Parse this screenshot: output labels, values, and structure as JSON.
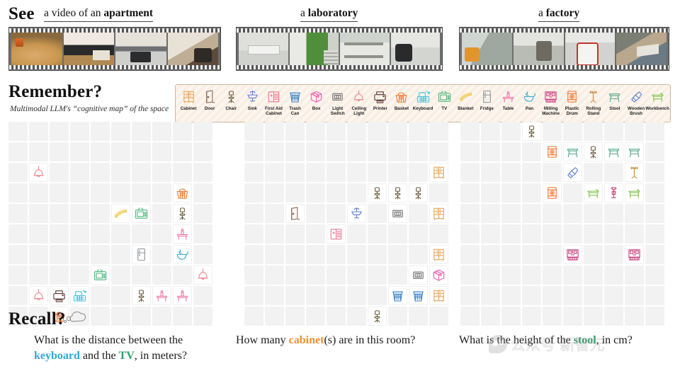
{
  "sections": {
    "see": "See",
    "remember": "Remember?",
    "recall": "Recall?",
    "remember_subtitle": "Multimodal LLM's “cognitive map” of the space"
  },
  "columns": [
    {
      "id": "apartment",
      "heading_prefix": "a video of an ",
      "heading_key": "apartment"
    },
    {
      "id": "laboratory",
      "heading_prefix": "a ",
      "heading_key": "laboratory"
    },
    {
      "id": "factory",
      "heading_prefix": "a ",
      "heading_key": "factory"
    }
  ],
  "legend": {
    "items": [
      {
        "name": "Cabinet",
        "icon": "cabinet",
        "color": "#E8A35C"
      },
      {
        "name": "Door",
        "icon": "door",
        "color": "#8A6B52"
      },
      {
        "name": "Chair",
        "icon": "chair",
        "color": "#6B5B3E"
      },
      {
        "name": "Sink",
        "icon": "sink",
        "color": "#5B7FC7"
      },
      {
        "name": "First Aid\nCabinet",
        "icon": "first-aid-cabinet",
        "color": "#F2728E"
      },
      {
        "name": "Trash\nCan",
        "icon": "trash-can",
        "color": "#3E86C9"
      },
      {
        "name": "Box",
        "icon": "box",
        "color": "#F25BB0"
      },
      {
        "name": "Light\nSwitch",
        "icon": "light-switch",
        "color": "#6E6E6E"
      },
      {
        "name": "Ceiling\nLight",
        "icon": "ceiling-light",
        "color": "#F2868E"
      },
      {
        "name": "Printer",
        "icon": "printer",
        "color": "#5C3A33"
      },
      {
        "name": "Basket",
        "icon": "basket",
        "color": "#F2742C"
      },
      {
        "name": "Keyboard",
        "icon": "keyboard",
        "color": "#3FC4D9"
      },
      {
        "name": "TV",
        "icon": "tv",
        "color": "#49B87B"
      },
      {
        "name": "Blanket",
        "icon": "blanket",
        "color": "#F2C94C"
      },
      {
        "name": "Fridge",
        "icon": "fridge",
        "color": "#8C9196"
      },
      {
        "name": "Table",
        "icon": "table",
        "color": "#F275A8"
      },
      {
        "name": "Pan",
        "icon": "pan",
        "color": "#2FA8D4"
      },
      {
        "name": "Milling\nMachine",
        "icon": "milling-machine",
        "color": "#C9407E"
      },
      {
        "name": "Plastic\nDrum",
        "icon": "plastic-drum",
        "color": "#F2722C"
      },
      {
        "name": "Rolling\nStand",
        "icon": "rolling-stand",
        "color": "#C98A3E"
      },
      {
        "name": "Stool",
        "icon": "stool",
        "color": "#4FA882"
      },
      {
        "name": "Wooden\nBrush",
        "icon": "wooden-brush",
        "color": "#5B7FC7"
      },
      {
        "name": "Workbench",
        "icon": "workbench",
        "color": "#7FC44F"
      }
    ]
  },
  "grids": {
    "apartment": {
      "rows": 10,
      "cols": 10,
      "items": [
        {
          "row": 2,
          "col": 1,
          "icon": "ceiling-light",
          "label": "Ceiling Light"
        },
        {
          "row": 3,
          "col": 8,
          "icon": "basket",
          "label": "Basket"
        },
        {
          "row": 4,
          "col": 5,
          "icon": "blanket",
          "label": "Blanket"
        },
        {
          "row": 4,
          "col": 6,
          "icon": "tv",
          "label": "TV"
        },
        {
          "row": 4,
          "col": 8,
          "icon": "chair",
          "label": "Chair"
        },
        {
          "row": 5,
          "col": 8,
          "icon": "table",
          "label": "Table"
        },
        {
          "row": 6,
          "col": 6,
          "icon": "fridge",
          "label": "Fridge"
        },
        {
          "row": 6,
          "col": 8,
          "icon": "pan",
          "label": "Pan"
        },
        {
          "row": 7,
          "col": 4,
          "icon": "tv",
          "label": "TV"
        },
        {
          "row": 7,
          "col": 9,
          "icon": "ceiling-light",
          "label": "Ceiling Light"
        },
        {
          "row": 8,
          "col": 1,
          "icon": "ceiling-light",
          "label": "Ceiling Light"
        },
        {
          "row": 8,
          "col": 2,
          "icon": "printer",
          "label": "Printer"
        },
        {
          "row": 8,
          "col": 3,
          "icon": "keyboard",
          "label": "Keyboard"
        },
        {
          "row": 8,
          "col": 6,
          "icon": "chair",
          "label": "Chair"
        },
        {
          "row": 8,
          "col": 7,
          "icon": "table",
          "label": "Table"
        },
        {
          "row": 8,
          "col": 8,
          "icon": "table",
          "label": "Table"
        },
        {
          "row": 9,
          "col": 2,
          "icon": "basket",
          "label": "Basket"
        }
      ]
    },
    "laboratory": {
      "rows": 10,
      "cols": 10,
      "items": [
        {
          "row": 2,
          "col": 9,
          "icon": "cabinet",
          "label": "Cabinet"
        },
        {
          "row": 3,
          "col": 6,
          "icon": "chair",
          "label": "Chair"
        },
        {
          "row": 3,
          "col": 7,
          "icon": "chair",
          "label": "Chair"
        },
        {
          "row": 3,
          "col": 8,
          "icon": "chair",
          "label": "Chair"
        },
        {
          "row": 4,
          "col": 2,
          "icon": "door",
          "label": "Door"
        },
        {
          "row": 4,
          "col": 5,
          "icon": "sink",
          "label": "Sink"
        },
        {
          "row": 4,
          "col": 7,
          "icon": "light-switch",
          "label": "Light Switch"
        },
        {
          "row": 4,
          "col": 9,
          "icon": "cabinet",
          "label": "Cabinet"
        },
        {
          "row": 5,
          "col": 4,
          "icon": "first-aid-cabinet",
          "label": "First Aid Cabinet"
        },
        {
          "row": 6,
          "col": 9,
          "icon": "cabinet",
          "label": "Cabinet"
        },
        {
          "row": 7,
          "col": 8,
          "icon": "light-switch",
          "label": "Light Switch"
        },
        {
          "row": 7,
          "col": 9,
          "icon": "box",
          "label": "Box"
        },
        {
          "row": 8,
          "col": 7,
          "icon": "trash-can",
          "label": "Trash Can"
        },
        {
          "row": 8,
          "col": 8,
          "icon": "trash-can",
          "label": "Trash Can"
        },
        {
          "row": 8,
          "col": 9,
          "icon": "cabinet",
          "label": "Cabinet"
        },
        {
          "row": 9,
          "col": 6,
          "icon": "chair",
          "label": "Chair"
        }
      ]
    },
    "factory": {
      "rows": 10,
      "cols": 10,
      "items": [
        {
          "row": 0,
          "col": 3,
          "icon": "chair",
          "label": "Chair"
        },
        {
          "row": 1,
          "col": 4,
          "icon": "plastic-drum",
          "label": "Plastic Drum"
        },
        {
          "row": 1,
          "col": 5,
          "icon": "stool",
          "label": "Stool"
        },
        {
          "row": 1,
          "col": 6,
          "icon": "chair",
          "label": "Chair"
        },
        {
          "row": 1,
          "col": 7,
          "icon": "stool",
          "label": "Stool"
        },
        {
          "row": 1,
          "col": 8,
          "icon": "stool",
          "label": "Stool"
        },
        {
          "row": 2,
          "col": 5,
          "icon": "wooden-brush",
          "label": "Wooden Brush"
        },
        {
          "row": 2,
          "col": 8,
          "icon": "rolling-stand",
          "label": "Rolling Stand"
        },
        {
          "row": 3,
          "col": 4,
          "icon": "plastic-drum",
          "label": "Plastic Drum"
        },
        {
          "row": 3,
          "col": 6,
          "icon": "workbench",
          "label": "Workbench"
        },
        {
          "row": 3,
          "col": 7,
          "icon": "milling-machine-sm",
          "label": "Milling Machine"
        },
        {
          "row": 3,
          "col": 8,
          "icon": "workbench",
          "label": "Workbench"
        },
        {
          "row": 6,
          "col": 5,
          "icon": "milling-machine",
          "label": "Milling Machine"
        },
        {
          "row": 6,
          "col": 8,
          "icon": "milling-machine",
          "label": "Milling Machine"
        }
      ]
    }
  },
  "questions": {
    "apartment": {
      "part1": "What is the distance between the ",
      "kw1": "keyboard",
      "kw1_color": "#2FA8D4",
      "part2": " and the ",
      "kw2": "TV",
      "kw2_color": "#2E9E6B",
      "part3": ", in meters?"
    },
    "laboratory": {
      "part1": "How many ",
      "kw1": "cabinet",
      "kw1_color": "#F2902C",
      "part2": "(s) are in this room?",
      "kw2": "",
      "kw2_color": "#F2902C",
      "part3": ""
    },
    "factory": {
      "part1": "What is the height of the ",
      "kw1": "stool",
      "kw1_color": "#2E9E6B",
      "part2": ", in cm?",
      "kw2": "",
      "kw2_color": "#2E9E6B",
      "part3": ""
    }
  },
  "watermark": {
    "text": "公众号 新智元"
  }
}
